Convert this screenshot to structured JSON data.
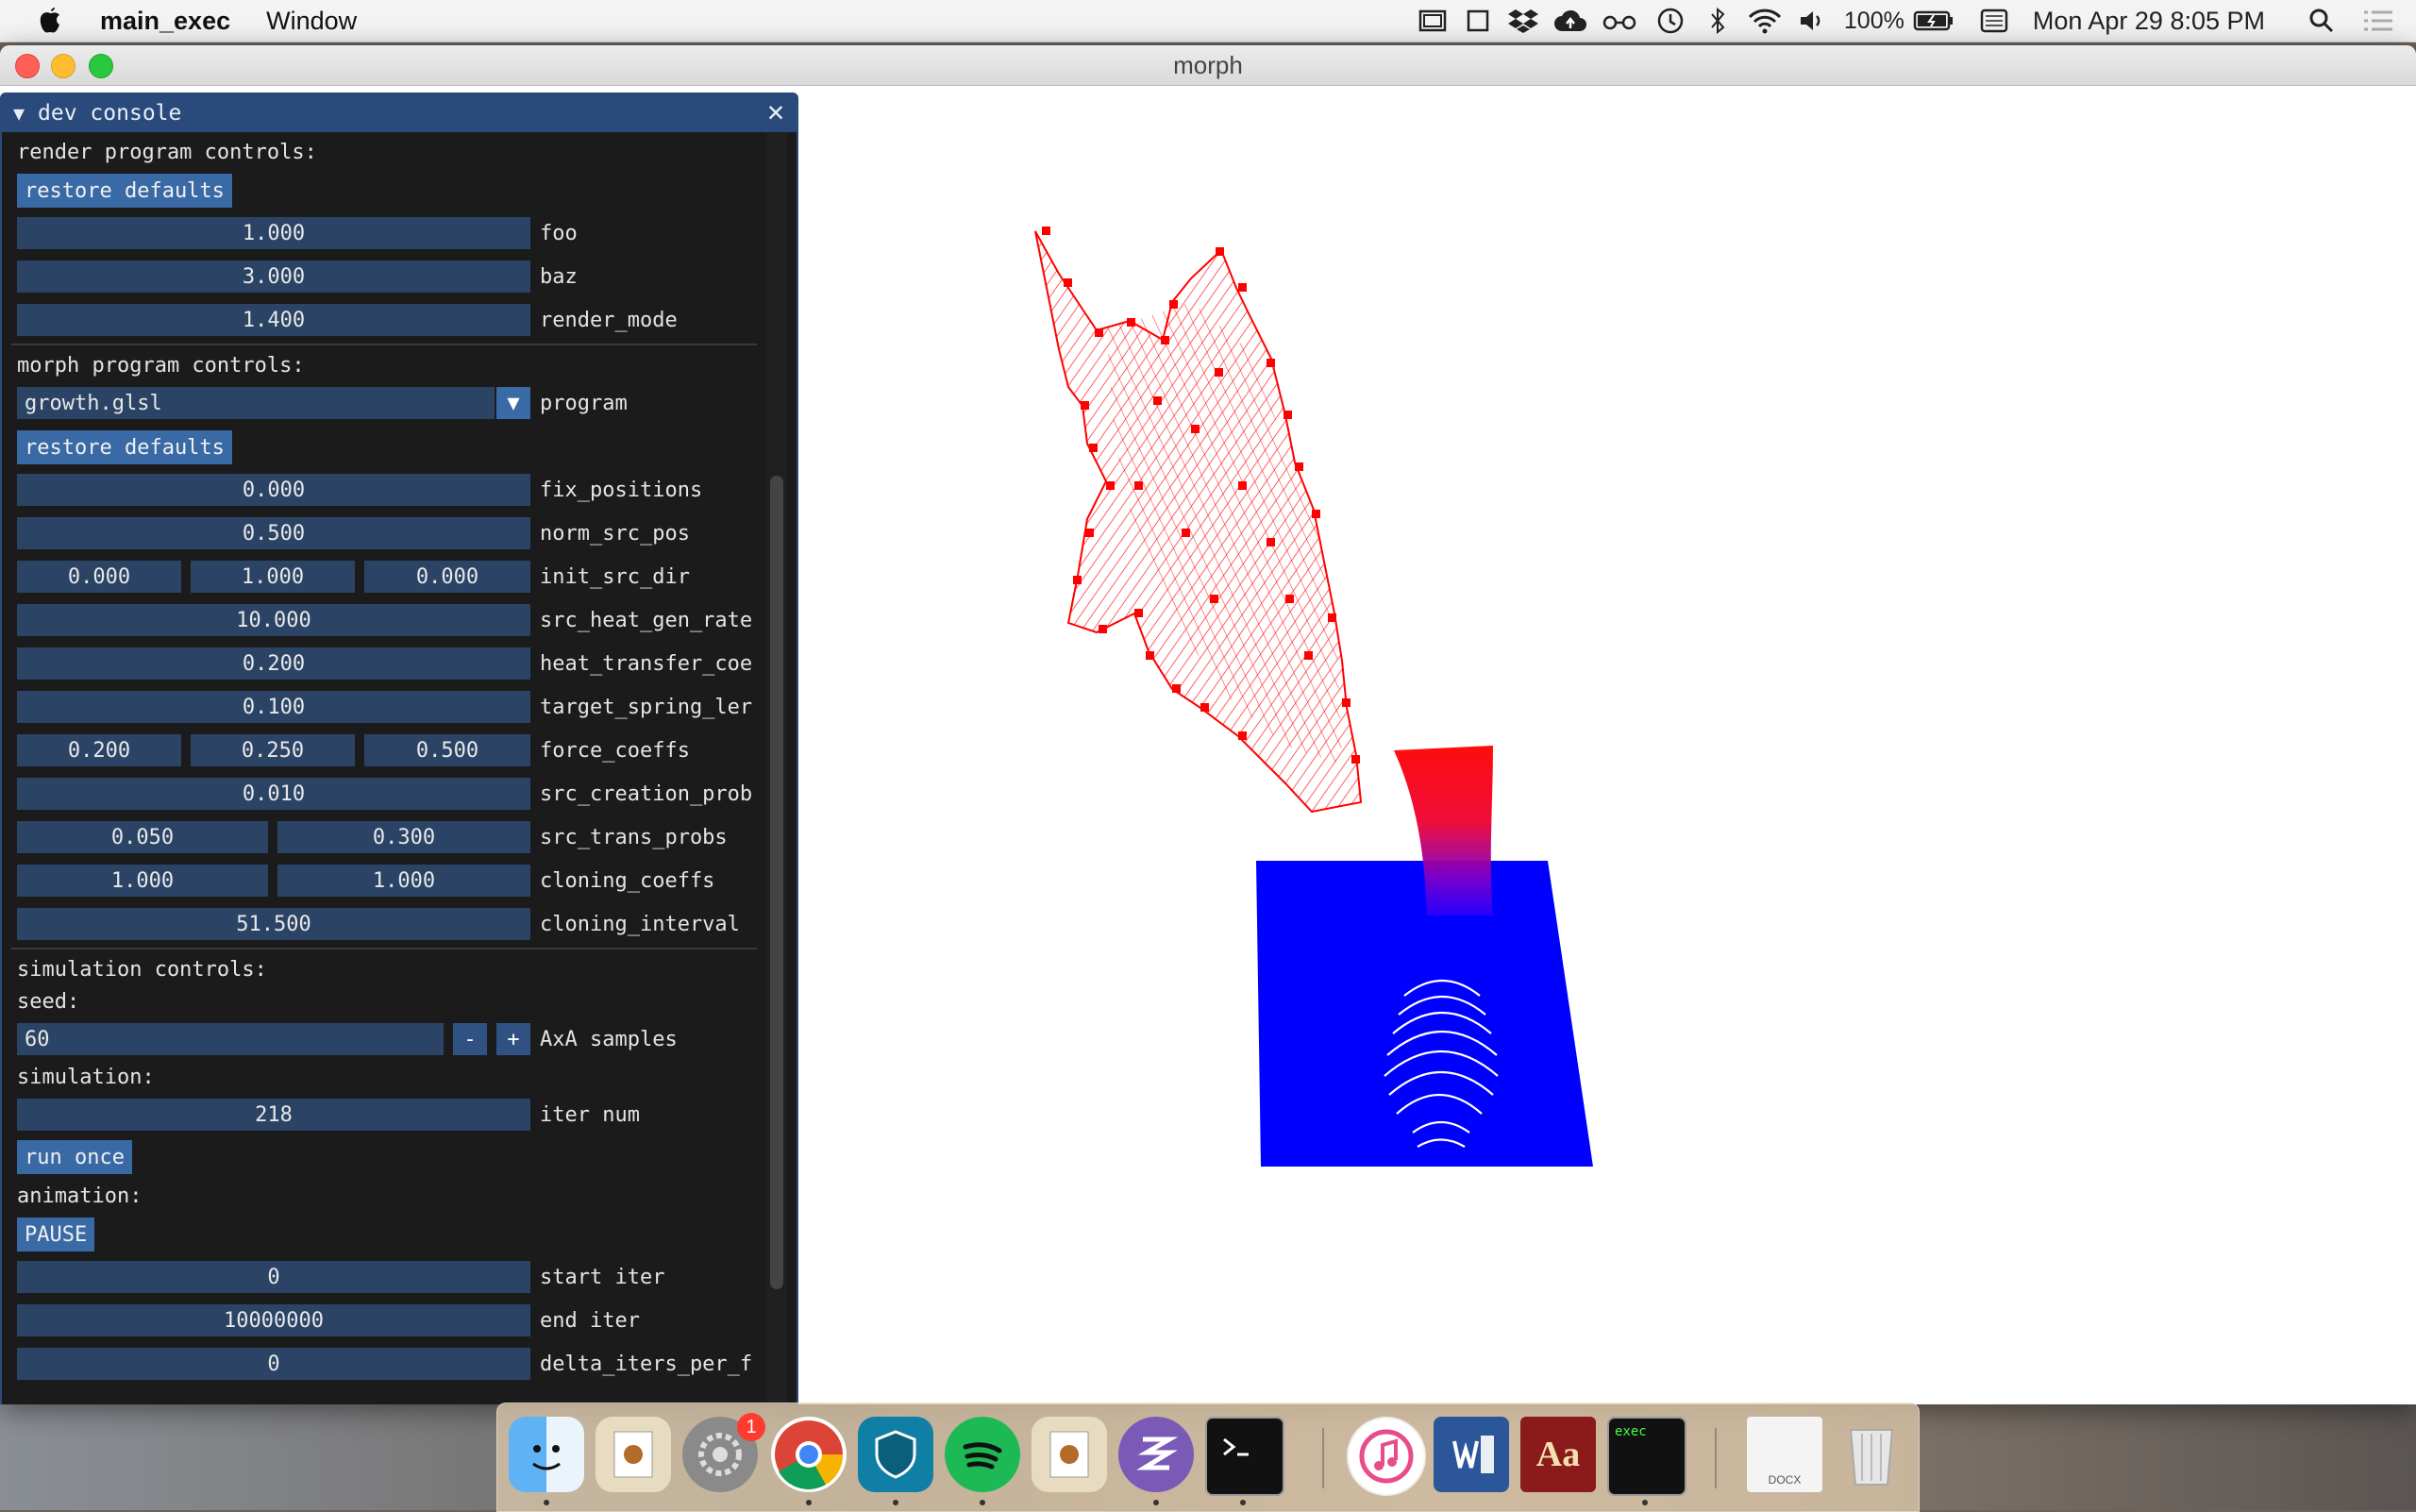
{
  "menubar": {
    "app_name": "main_exec",
    "menu_window": "Window",
    "battery": "100%",
    "datetime": "Mon Apr 29  8:05 PM"
  },
  "window": {
    "title": "morph"
  },
  "console": {
    "title": "dev console",
    "render_section": "render program controls:",
    "restore_defaults": "restore defaults",
    "render_params": [
      {
        "value": "1.000",
        "label": "foo"
      },
      {
        "value": "3.000",
        "label": "baz"
      },
      {
        "value": "1.400",
        "label": "render_mode"
      }
    ],
    "morph_section": "morph program controls:",
    "program_value": "growth.glsl",
    "program_label": "program",
    "morph_restore_defaults": "restore defaults",
    "morph_params": {
      "fix_positions": {
        "value": "0.000",
        "label": "fix_positions"
      },
      "norm_src_pos": {
        "value": "0.500",
        "label": "norm_src_pos"
      },
      "init_src_dir": {
        "values": [
          "0.000",
          "1.000",
          "0.000"
        ],
        "label": "init_src_dir"
      },
      "src_heat_gen_rate": {
        "value": "10.000",
        "label": "src_heat_gen_rate"
      },
      "heat_transfer_coeff": {
        "value": "0.200",
        "label": "heat_transfer_coe"
      },
      "target_spring_len": {
        "value": "0.100",
        "label": "target_spring_ler"
      },
      "force_coeffs": {
        "values": [
          "0.200",
          "0.250",
          "0.500"
        ],
        "label": "force_coeffs"
      },
      "src_creation_prob": {
        "value": "0.010",
        "label": "src_creation_prob"
      },
      "src_trans_probs": {
        "values": [
          "0.050",
          "0.300"
        ],
        "label": "src_trans_probs"
      },
      "cloning_coeffs": {
        "values": [
          "1.000",
          "1.000"
        ],
        "label": "cloning_coeffs"
      },
      "cloning_interval": {
        "value": "51.500",
        "label": "cloning_interval"
      }
    },
    "simulation_section": "simulation controls:",
    "seed_label": "seed:",
    "seed_value": "60",
    "minus": "-",
    "plus": "+",
    "axa_label": "AxA samples",
    "simulation_label": "simulation:",
    "iter_num_value": "218",
    "iter_num_label": "iter num",
    "run_once": "run once",
    "animation_label": "animation:",
    "pause": "PAUSE",
    "start_iter_value": "0",
    "start_iter_label": "start iter",
    "end_iter_value": "10000000",
    "end_iter_label": "end iter",
    "delta_value": "0",
    "delta_label": "delta_iters_per_f"
  },
  "dock": {
    "badge_count": "1",
    "docx_label": "DOCX",
    "exec_label": "exec",
    "dictionary_glyph": "Aa"
  },
  "colors": {
    "mesh_top": "#ff0000",
    "mesh_bottom": "#0000ff",
    "console_header": "#294a7a",
    "field_bg": "#2b4465"
  }
}
